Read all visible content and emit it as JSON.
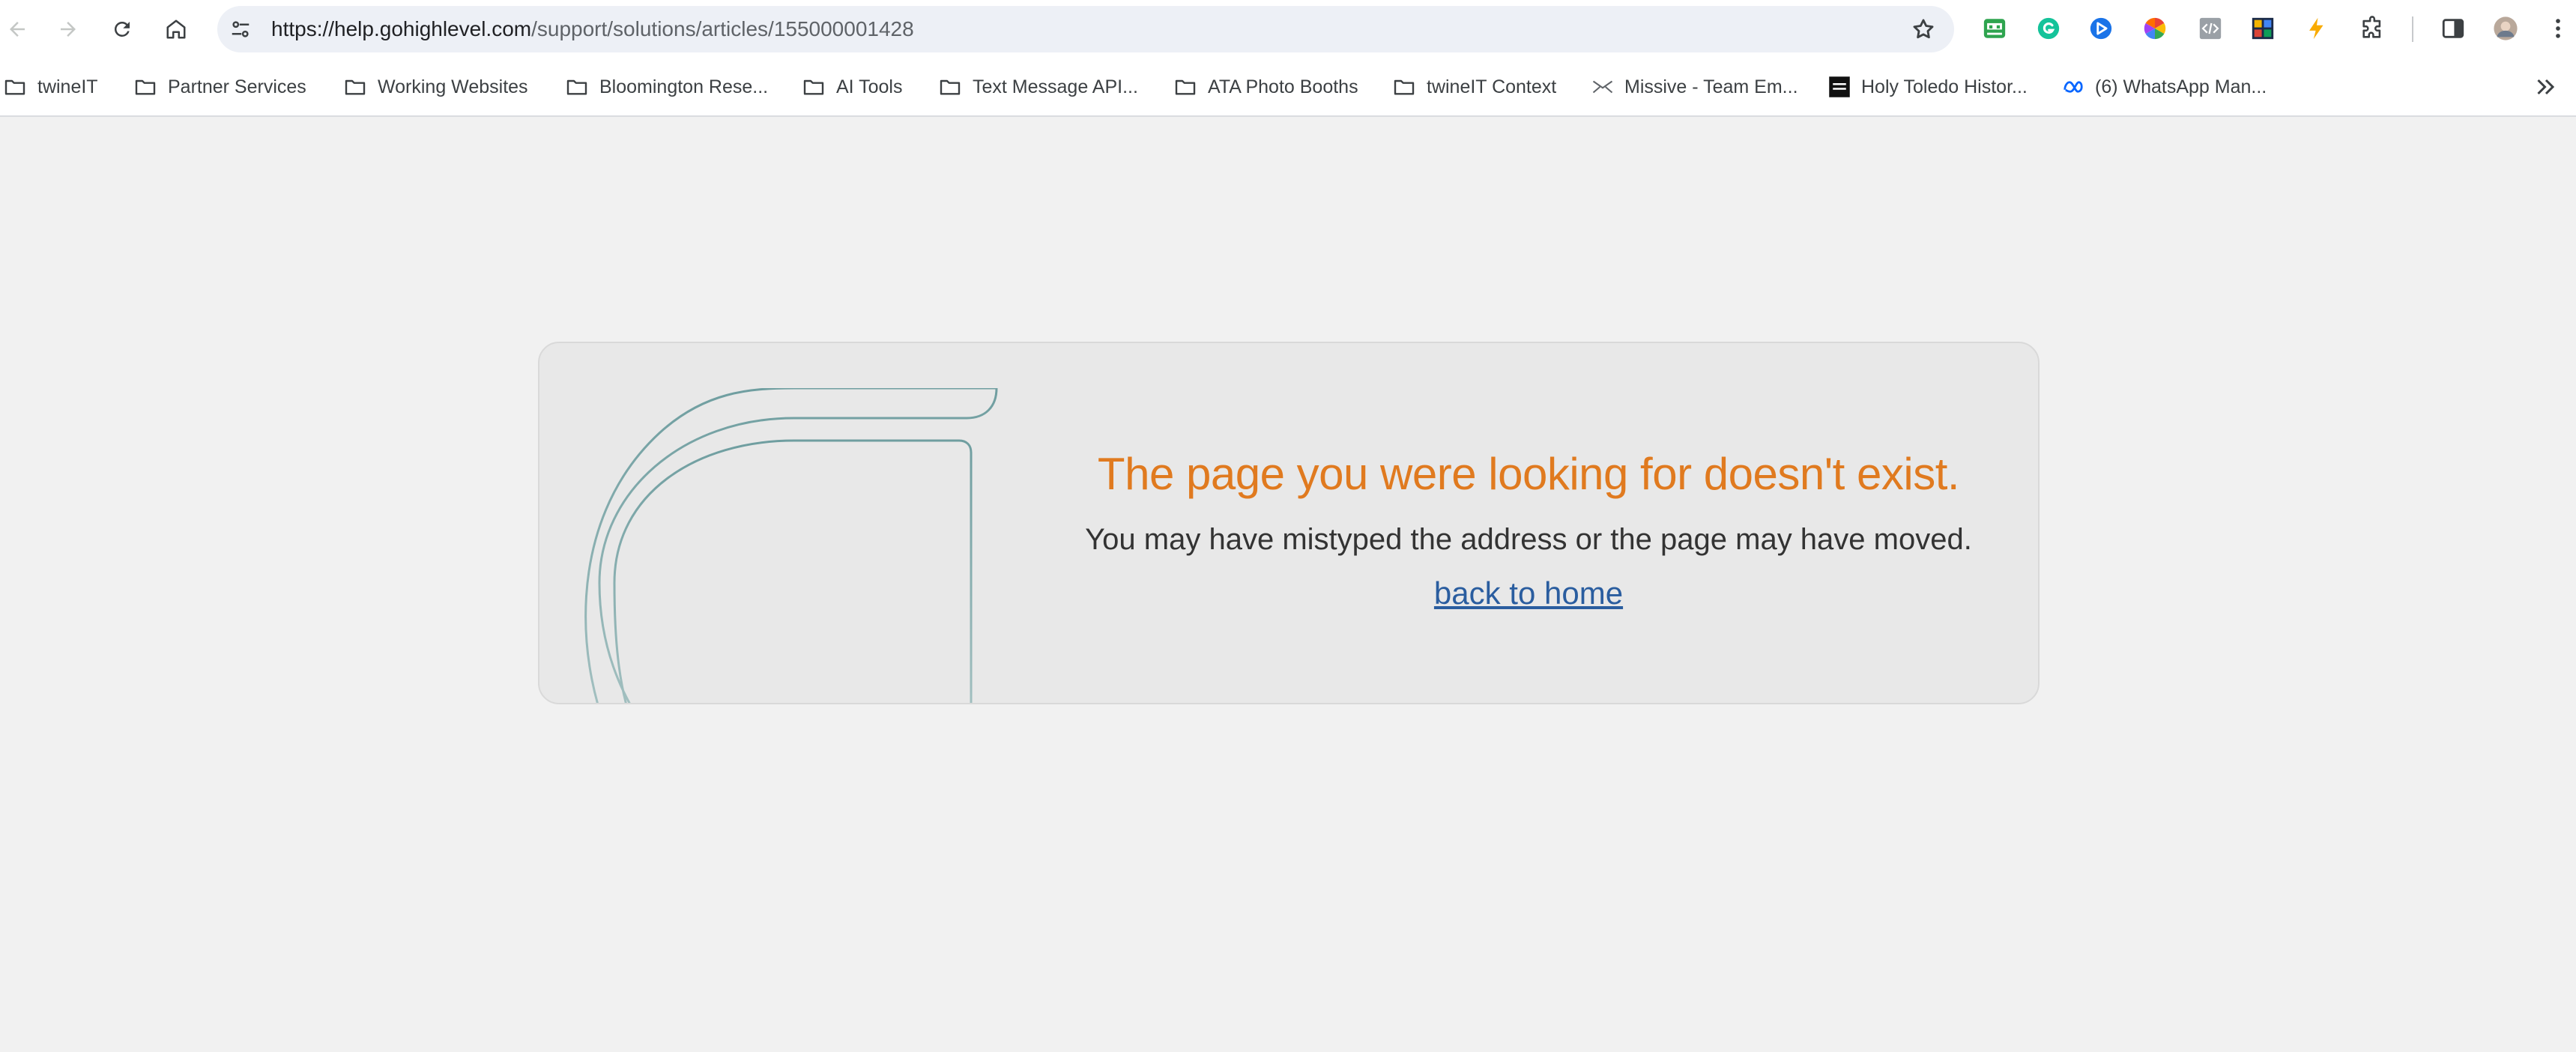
{
  "browser": {
    "url_host": "https://help.gohighlevel.com",
    "url_path": "/support/solutions/articles/155000001428",
    "nav": {
      "back_icon": "arrow-left-icon",
      "forward_icon": "arrow-right-icon",
      "reload_icon": "reload-icon",
      "home_icon": "home-icon"
    },
    "extensions": [
      "reader-extension-icon",
      "grammarly-icon",
      "blue-play-extension-icon",
      "color-picker-icon",
      "code-extension-icon",
      "puzzle-art-extension-icon",
      "bolt-extension-icon",
      "extensions-icon",
      "side-panel-icon",
      "profile-avatar",
      "menu-icon"
    ]
  },
  "bookmarks": [
    {
      "label": "twineIT",
      "icon": "folder-icon"
    },
    {
      "label": "Partner Services",
      "icon": "folder-icon"
    },
    {
      "label": "Working Websites",
      "icon": "folder-icon"
    },
    {
      "label": "Bloomington Rese...",
      "icon": "folder-icon"
    },
    {
      "label": "AI Tools",
      "icon": "folder-icon"
    },
    {
      "label": "Text Message API...",
      "icon": "folder-icon"
    },
    {
      "label": "ATA Photo Booths",
      "icon": "folder-icon"
    },
    {
      "label": "twineIT Context",
      "icon": "folder-icon"
    },
    {
      "label": "Missive - Team Em...",
      "icon": "missive-icon"
    },
    {
      "label": "Holy Toledo Histor...",
      "icon": "holy-toledo-icon"
    },
    {
      "label": "(6) WhatsApp Man...",
      "icon": "meta-icon"
    }
  ],
  "error_page": {
    "title": "The page you were looking for doesn't exist.",
    "subtitle": "You may have mistyped the address or the page may have moved.",
    "home_link": "back to home"
  },
  "colors": {
    "title": "#e07a1f",
    "link": "#2a5d9f",
    "logo_stroke": "#6f9ea0"
  }
}
